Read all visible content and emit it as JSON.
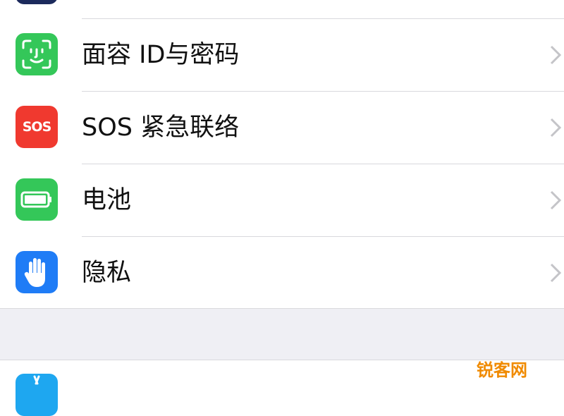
{
  "settings": {
    "items": [
      {
        "label": "面容 ID与密码",
        "icon": "face-id-icon",
        "color": "#34c759"
      },
      {
        "label": "SOS 紧急联络",
        "icon": "sos-icon",
        "color": "#ff3b30",
        "icon_text": "SOS"
      },
      {
        "label": "电池",
        "icon": "battery-icon",
        "color": "#34c759"
      },
      {
        "label": "隐私",
        "icon": "hand-icon",
        "color": "#1f7cf6"
      }
    ],
    "next_item": {
      "icon": "app-store-icon",
      "color": "#1ea7f0"
    }
  },
  "watermark": "锐客网"
}
